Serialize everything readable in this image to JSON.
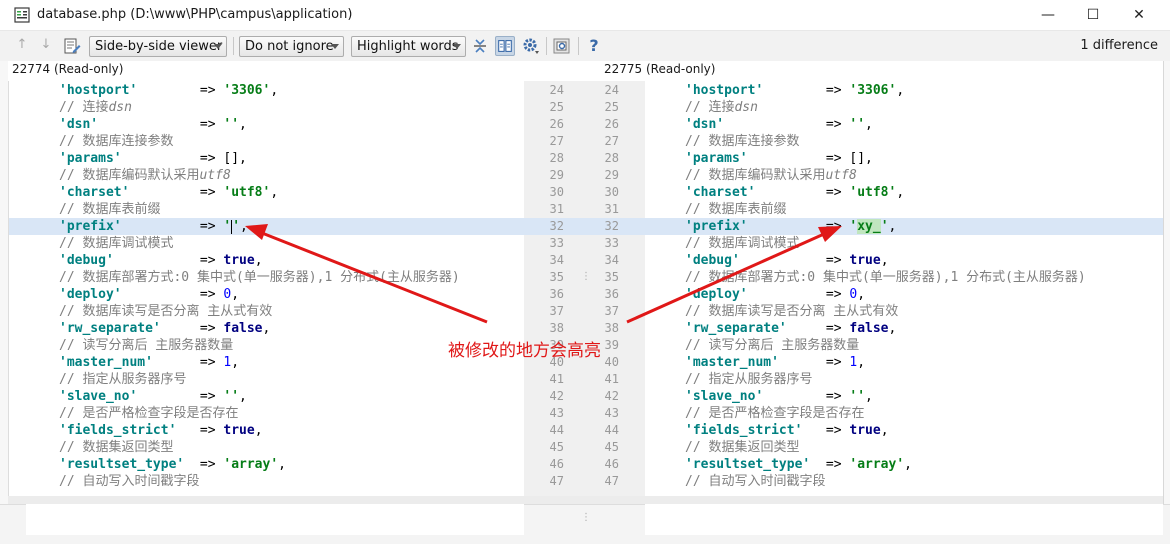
{
  "window": {
    "title": "database.php (D:\\www\\PHP\\campus\\application)",
    "minimize": "—",
    "maximize": "☐",
    "close": "✕"
  },
  "toolbar": {
    "prev_diff": "↑",
    "next_diff": "↓",
    "viewer_mode": "Side-by-side viewer",
    "ignore_mode": "Do not ignore",
    "highlight_mode": "Highlight words",
    "help": "?",
    "difference_count": "1 difference"
  },
  "panels": {
    "left_header": "22774 (Read-only)",
    "right_header": "22775 (Read-only)"
  },
  "lines": [
    {
      "n": "24",
      "key": "'hostport'",
      "pad": "        ",
      "val": "'3306'",
      "type": "s"
    },
    {
      "n": "25",
      "comment": "// 连接",
      "ital": "dsn"
    },
    {
      "n": "26",
      "key": "'dsn'",
      "pad": "             ",
      "val": "''",
      "type": "s"
    },
    {
      "n": "27",
      "comment": "// 数据库连接参数",
      "ital": ""
    },
    {
      "n": "28",
      "key": "'params'",
      "pad": "          ",
      "val": "[]",
      "type": "op"
    },
    {
      "n": "29",
      "comment": "// 数据库编码默认采用",
      "ital": "utf8"
    },
    {
      "n": "30",
      "key": "'charset'",
      "pad": "         ",
      "val": "'utf8'",
      "type": "s"
    },
    {
      "n": "31",
      "comment": "// 数据库表前缀",
      "ital": ""
    },
    {
      "n": "32",
      "key": "'prefix'",
      "pad": "          ",
      "val": "''",
      "type": "s",
      "right_val": "xy_",
      "changed": true
    },
    {
      "n": "33",
      "comment": "// 数据库调试模式",
      "ital": ""
    },
    {
      "n": "34",
      "key": "'debug'",
      "pad": "           ",
      "val": "true",
      "type": "kw"
    },
    {
      "n": "35",
      "comment": "// 数据库部署方式:0 集中式(单一服务器),1 分布式(主从服务器)",
      "ital": ""
    },
    {
      "n": "36",
      "key": "'deploy'",
      "pad": "          ",
      "val": "0",
      "type": "num"
    },
    {
      "n": "37",
      "comment": "// 数据库读写是否分离 主从式有效",
      "ital": ""
    },
    {
      "n": "38",
      "key": "'rw_separate'",
      "pad": "     ",
      "val": "false",
      "type": "kw"
    },
    {
      "n": "39",
      "comment": "// 读写分离后 主服务器数量",
      "ital": ""
    },
    {
      "n": "40",
      "key": "'master_num'",
      "pad": "      ",
      "val": "1",
      "type": "num"
    },
    {
      "n": "41",
      "comment": "// 指定从服务器序号",
      "ital": ""
    },
    {
      "n": "42",
      "key": "'slave_no'",
      "pad": "        ",
      "val": "''",
      "type": "s"
    },
    {
      "n": "43",
      "comment": "// 是否严格检查字段是否存在",
      "ital": ""
    },
    {
      "n": "44",
      "key": "'fields_strict'",
      "pad": "   ",
      "val": "true",
      "type": "kw"
    },
    {
      "n": "45",
      "comment": "// 数据集返回类型",
      "ital": ""
    },
    {
      "n": "46",
      "key": "'resultset_type'",
      "pad": "  ",
      "val": "'array'",
      "type": "s"
    },
    {
      "n": "47",
      "comment": "// 自动写入时间戳字段",
      "ital": ""
    }
  ],
  "annotation": {
    "text": "被修改的地方会高亮",
    "color": "#e01818"
  },
  "colors": {
    "changed_line": "#d9e6f6",
    "changed_word": "#c0e6bf",
    "string": "#067d17",
    "key": "#008080",
    "keyword": "#000080",
    "number": "#0000ff",
    "comment": "#7f7f7f"
  }
}
